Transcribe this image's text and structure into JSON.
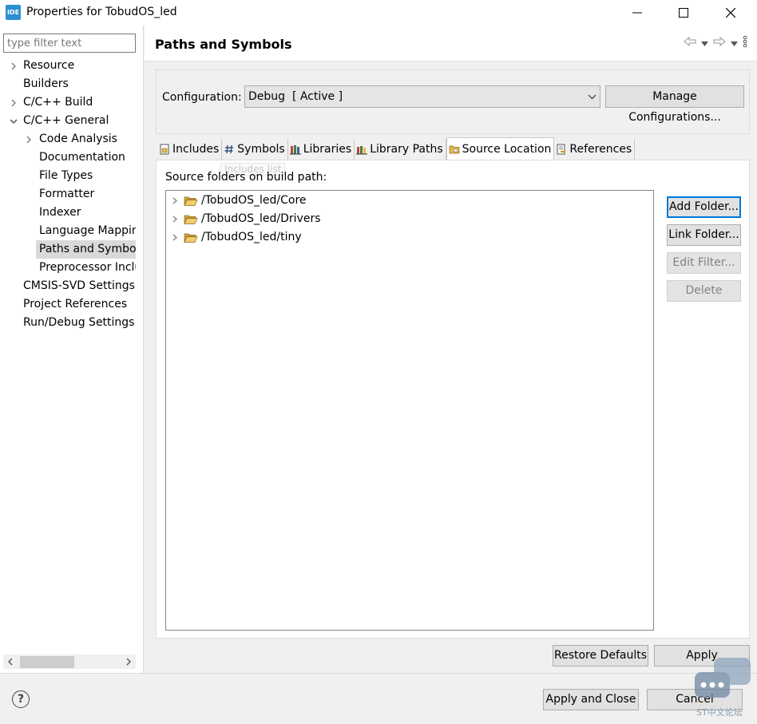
{
  "window": {
    "app_badge": "IDE",
    "title": "Properties for TobudOS_led"
  },
  "sidebar": {
    "filter_placeholder": "type filter text",
    "items": [
      {
        "label": "Resource",
        "expander": "collapsed",
        "level": 0
      },
      {
        "label": "Builders",
        "expander": "none",
        "level": 0
      },
      {
        "label": "C/C++ Build",
        "expander": "collapsed",
        "level": 0
      },
      {
        "label": "C/C++ General",
        "expander": "expanded",
        "level": 0
      },
      {
        "label": "Code Analysis",
        "expander": "collapsed",
        "level": 1
      },
      {
        "label": "Documentation",
        "expander": "none",
        "level": 1
      },
      {
        "label": "File Types",
        "expander": "none",
        "level": 1
      },
      {
        "label": "Formatter",
        "expander": "none",
        "level": 1
      },
      {
        "label": "Indexer",
        "expander": "none",
        "level": 1
      },
      {
        "label": "Language Mappings",
        "expander": "none",
        "level": 1
      },
      {
        "label": "Paths and Symbols",
        "expander": "none",
        "level": 1,
        "selected": true
      },
      {
        "label": "Preprocessor Include",
        "expander": "none",
        "level": 1
      },
      {
        "label": "CMSIS-SVD Settings",
        "expander": "none",
        "level": 0
      },
      {
        "label": "Project References",
        "expander": "none",
        "level": 0
      },
      {
        "label": "Run/Debug Settings",
        "expander": "none",
        "level": 0
      }
    ]
  },
  "page": {
    "title": "Paths and Symbols"
  },
  "configuration": {
    "label": "Configuration:",
    "selected": "Debug  [ Active ]",
    "manage_label": "Manage Configurations..."
  },
  "tabs": [
    {
      "label": "Includes",
      "icon": "includes-icon"
    },
    {
      "label": "Symbols",
      "icon": "hash-icon"
    },
    {
      "label": "Libraries",
      "icon": "libraries-icon"
    },
    {
      "label": "Library Paths",
      "icon": "library-paths-icon"
    },
    {
      "label": "Source Location",
      "icon": "source-folder-icon",
      "active": true
    },
    {
      "label": "References",
      "icon": "references-icon"
    }
  ],
  "source_location": {
    "heading": "Source folders on build path:",
    "ghost_tooltip": "Includes list",
    "folders": [
      "/TobudOS_led/Core",
      "/TobudOS_led/Drivers",
      "/TobudOS_led/tiny"
    ],
    "buttons": {
      "add_folder": "Add Folder...",
      "link_folder": "Link Folder...",
      "edit_filter": "Edit Filter...",
      "delete": "Delete"
    }
  },
  "actions": {
    "restore_defaults": "Restore Defaults",
    "apply": "Apply",
    "apply_and_close": "Apply and Close",
    "cancel": "Cancel"
  },
  "watermark": {
    "text": "ST中文论坛"
  },
  "colors": {
    "accent": "#0078d7",
    "folder": "#e8b84a",
    "selection": "#d9d9d9"
  }
}
